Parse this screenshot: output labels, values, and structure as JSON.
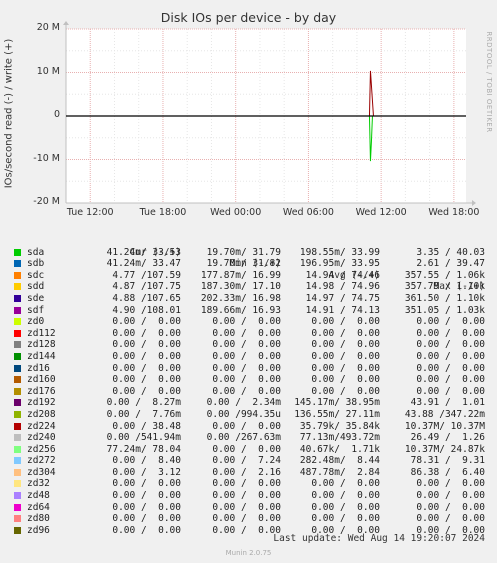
{
  "chart_data": {
    "type": "line",
    "title": "Disk IOs per device - by day",
    "ylabel": "IOs/second read (-) / write (+)",
    "ylim": [
      -20000000,
      20000000
    ],
    "y_ticks": [
      {
        "value": 20000000,
        "label": "20 M"
      },
      {
        "value": 10000000,
        "label": "10 M"
      },
      {
        "value": 0,
        "label": "0"
      },
      {
        "value": -10000000,
        "label": "-10 M"
      },
      {
        "value": -20000000,
        "label": "-20 M"
      }
    ],
    "x_ticks": [
      "Tue 12:00",
      "Tue 18:00",
      "Wed 00:00",
      "Wed 06:00",
      "Wed 12:00",
      "Wed 18:00"
    ],
    "x_range_hours": [
      0,
      33
    ],
    "x_tick_hours": [
      2,
      8,
      14,
      20,
      26,
      32
    ],
    "grid": true,
    "spike": {
      "time_hours": 25.2,
      "write_peak": 10370000,
      "read_peak": -10370000,
      "write_color": "#990000",
      "read_color": "#00cc00"
    },
    "legend_header": {
      "cur": "Cur (-/+)",
      "min": "Min (-/+)",
      "avg": "Avg (-/+)",
      "max": "Max (-/+)"
    },
    "series": [
      {
        "name": "sda",
        "color": "#00cc00",
        "cur": "41.24m/ 33.53",
        "min": "19.70m/ 31.79",
        "avg": "198.55m/ 33.99",
        "max": "3.35 / 40.03"
      },
      {
        "name": "sdb",
        "color": "#0066b3",
        "cur": "41.24m/ 33.47",
        "min": "19.70m/ 31.82",
        "avg": "196.95m/ 33.95",
        "max": "2.61 / 39.47"
      },
      {
        "name": "sdc",
        "color": "#ff8000",
        "cur": "4.77 /107.59",
        "min": "177.87m/ 16.99",
        "avg": "14.94 / 74.46",
        "max": "357.55 / 1.06k"
      },
      {
        "name": "sdd",
        "color": "#ffcc00",
        "cur": "4.87 /107.75",
        "min": "187.30m/ 17.10",
        "avg": "14.98 / 74.96",
        "max": "357.79 / 1.10k"
      },
      {
        "name": "sde",
        "color": "#330099",
        "cur": "4.88 /107.65",
        "min": "202.33m/ 16.98",
        "avg": "14.97 / 74.75",
        "max": "361.50 / 1.10k"
      },
      {
        "name": "sdf",
        "color": "#990099",
        "cur": "4.90 /108.01",
        "min": "189.66m/ 16.93",
        "avg": "14.91 / 74.13",
        "max": "351.05 / 1.03k"
      },
      {
        "name": "zd0",
        "color": "#ccff00",
        "cur": "0.00 /  0.00",
        "min": "0.00 /  0.00",
        "avg": "0.00 /  0.00",
        "max": "0.00 /  0.00"
      },
      {
        "name": "zd112",
        "color": "#ff0000",
        "cur": "0.00 /  0.00",
        "min": "0.00 /  0.00",
        "avg": "0.00 /  0.00",
        "max": "0.00 /  0.00"
      },
      {
        "name": "zd128",
        "color": "#808080",
        "cur": "0.00 /  0.00",
        "min": "0.00 /  0.00",
        "avg": "0.00 /  0.00",
        "max": "0.00 /  0.00"
      },
      {
        "name": "zd144",
        "color": "#008f00",
        "cur": "0.00 /  0.00",
        "min": "0.00 /  0.00",
        "avg": "0.00 /  0.00",
        "max": "0.00 /  0.00"
      },
      {
        "name": "zd16",
        "color": "#00487d",
        "cur": "0.00 /  0.00",
        "min": "0.00 /  0.00",
        "avg": "0.00 /  0.00",
        "max": "0.00 /  0.00"
      },
      {
        "name": "zd160",
        "color": "#b35a00",
        "cur": "0.00 /  0.00",
        "min": "0.00 /  0.00",
        "avg": "0.00 /  0.00",
        "max": "0.00 /  0.00"
      },
      {
        "name": "zd176",
        "color": "#b38f00",
        "cur": "0.00 /  0.00",
        "min": "0.00 /  0.00",
        "avg": "0.00 /  0.00",
        "max": "0.00 /  0.00"
      },
      {
        "name": "zd192",
        "color": "#6b006b",
        "cur": "0.00 /  8.27m",
        "min": "0.00 /  2.34m",
        "avg": "145.17m/ 38.95m",
        "max": "43.91 /  1.01"
      },
      {
        "name": "zd208",
        "color": "#8fb300",
        "cur": "0.00 /  7.76m",
        "min": "0.00 /994.35u",
        "avg": "136.55m/ 27.11m",
        "max": "43.88 /347.22m"
      },
      {
        "name": "zd224",
        "color": "#b30000",
        "cur": "0.00 / 38.48",
        "min": "0.00 /  0.00",
        "avg": "35.79k/ 35.84k",
        "max": "10.37M/ 10.37M"
      },
      {
        "name": "zd240",
        "color": "#bebebe",
        "cur": "0.00 /541.94m",
        "min": "0.00 /267.63m",
        "avg": "77.13m/493.72m",
        "max": "26.49 /  1.26"
      },
      {
        "name": "zd256",
        "color": "#80ff80",
        "cur": "77.24m/ 78.04",
        "min": "0.00 /  0.00",
        "avg": "40.67k/  1.71k",
        "max": "10.37M/ 24.87k"
      },
      {
        "name": "zd272",
        "color": "#80c9ff",
        "cur": "0.00 /  8.40",
        "min": "0.00 /  7.24",
        "avg": "282.48m/  8.44",
        "max": "78.31 /  9.31"
      },
      {
        "name": "zd304",
        "color": "#ffc080",
        "cur": "0.00 /  3.12",
        "min": "0.00 /  2.16",
        "avg": "487.78m/  2.84",
        "max": "86.38 /  6.40"
      },
      {
        "name": "zd32",
        "color": "#ffe680",
        "cur": "0.00 /  0.00",
        "min": "0.00 /  0.00",
        "avg": "0.00 /  0.00",
        "max": "0.00 /  0.00"
      },
      {
        "name": "zd48",
        "color": "#aa80ff",
        "cur": "0.00 /  0.00",
        "min": "0.00 /  0.00",
        "avg": "0.00 /  0.00",
        "max": "0.00 /  0.00"
      },
      {
        "name": "zd64",
        "color": "#ee00cc",
        "cur": "0.00 /  0.00",
        "min": "0.00 /  0.00",
        "avg": "0.00 /  0.00",
        "max": "0.00 /  0.00"
      },
      {
        "name": "zd80",
        "color": "#ff8080",
        "cur": "0.00 /  0.00",
        "min": "0.00 /  0.00",
        "avg": "0.00 /  0.00",
        "max": "0.00 /  0.00"
      },
      {
        "name": "zd96",
        "color": "#666600",
        "cur": "0.00 /  0.00",
        "min": "0.00 /  0.00",
        "avg": "0.00 /  0.00",
        "max": "0.00 /  0.00"
      }
    ]
  },
  "footer": {
    "last_update": "Last update:  Wed Aug 14 19:20:07 2024",
    "munin_version": "Munin 2.0.75",
    "side_credit": "RRDTOOL / TOBI OETIKER"
  }
}
